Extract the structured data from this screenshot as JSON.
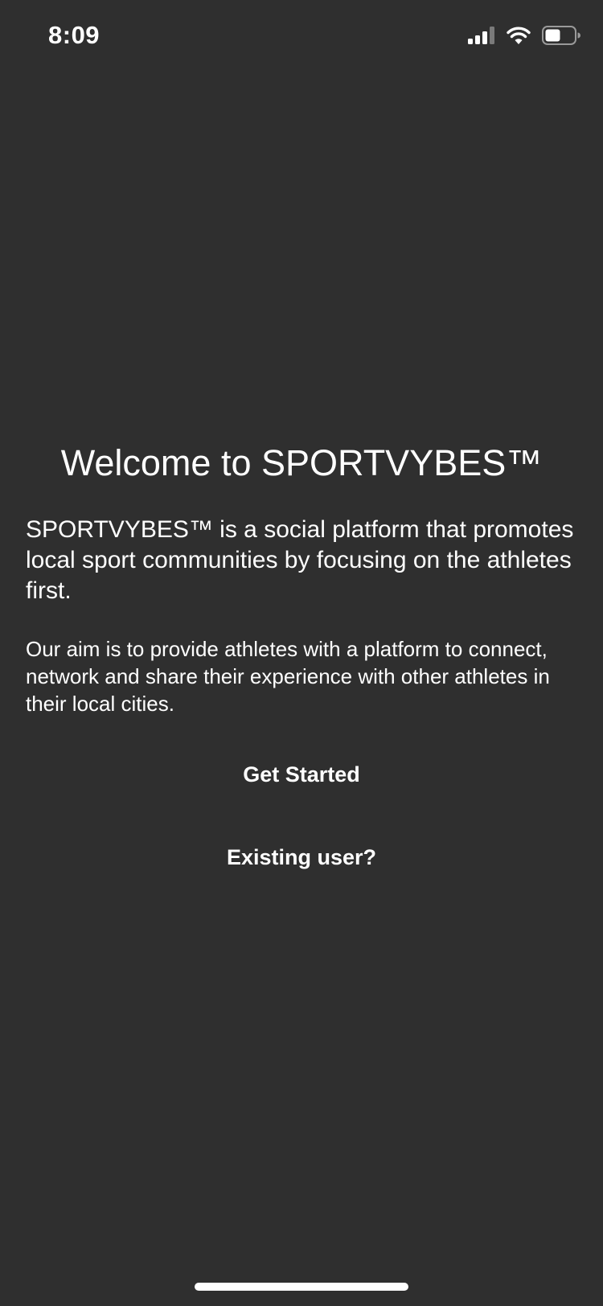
{
  "status_bar": {
    "time": "8:09",
    "icons": [
      "signal-icon",
      "wifi-icon",
      "battery-icon"
    ],
    "battery_level": 0.5
  },
  "welcome": {
    "title": "Welcome to SPORTVYBES™",
    "intro": "SPORTVYBES™ is a social platform that promotes local sport communities by focusing on the athletes first.",
    "aim": "Our aim is to provide athletes with a platform to connect, network and share their experience with other athletes in their local cities."
  },
  "actions": {
    "get_started_label": "Get Started",
    "existing_user_label": "Existing user?"
  },
  "colors": {
    "background": "#2f2f2f",
    "text": "#ffffff"
  }
}
